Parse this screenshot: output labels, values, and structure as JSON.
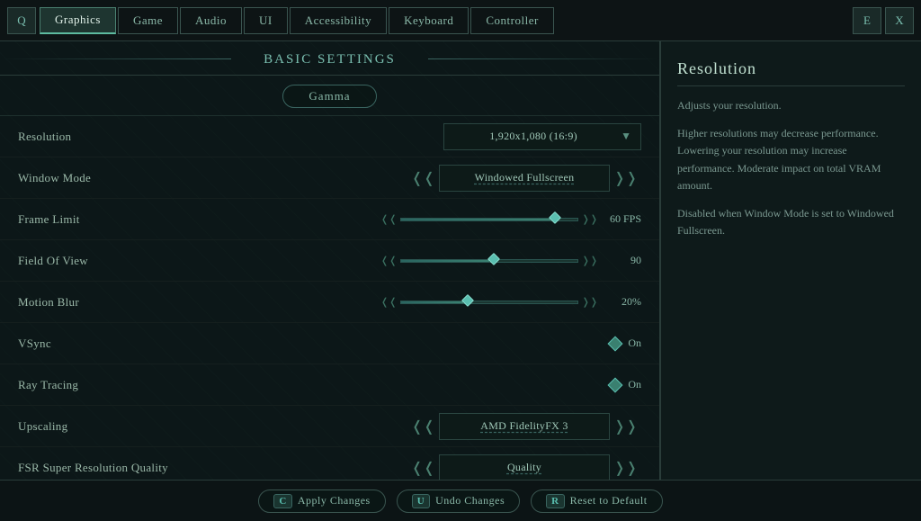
{
  "nav": {
    "q_label": "Q",
    "e_label": "E",
    "x_label": "X",
    "tabs": [
      {
        "id": "graphics",
        "label": "Graphics",
        "active": true
      },
      {
        "id": "game",
        "label": "Game",
        "active": false
      },
      {
        "id": "audio",
        "label": "Audio",
        "active": false
      },
      {
        "id": "ui",
        "label": "UI",
        "active": false
      },
      {
        "id": "accessibility",
        "label": "Accessibility",
        "active": false
      },
      {
        "id": "keyboard",
        "label": "Keyboard",
        "active": false
      },
      {
        "id": "controller",
        "label": "Controller",
        "active": false
      }
    ]
  },
  "section": {
    "title": "Basic Settings"
  },
  "gamma_btn": "Gamma",
  "settings": [
    {
      "id": "resolution",
      "label": "Resolution",
      "type": "dropdown",
      "value": "1,920x1,080 (16:9)"
    },
    {
      "id": "window-mode",
      "label": "Window Mode",
      "type": "arrow-select",
      "value": "Windowed Fullscreen"
    },
    {
      "id": "frame-limit",
      "label": "Frame Limit",
      "type": "slider",
      "value": "60 FPS",
      "fill_pct": 85
    },
    {
      "id": "field-of-view",
      "label": "Field Of View",
      "type": "slider",
      "value": "90",
      "fill_pct": 50
    },
    {
      "id": "motion-blur",
      "label": "Motion Blur",
      "type": "slider",
      "value": "20%",
      "fill_pct": 35
    },
    {
      "id": "vsync",
      "label": "VSync",
      "type": "toggle",
      "value": "On"
    },
    {
      "id": "ray-tracing",
      "label": "Ray Tracing",
      "type": "toggle",
      "value": "On"
    },
    {
      "id": "upscaling",
      "label": "Upscaling",
      "type": "arrow-select",
      "value": "AMD FidelityFX 3"
    },
    {
      "id": "fsr-quality",
      "label": "FSR Super Resolution Quality",
      "type": "arrow-select",
      "value": "Quality"
    }
  ],
  "info_panel": {
    "title": "Resolution",
    "paragraphs": [
      "Adjusts your resolution.",
      "Higher resolutions may decrease performance. Lowering your resolution may increase performance. Moderate impact on total VRAM amount.",
      "Disabled when Window Mode is set to Windowed Fullscreen."
    ]
  },
  "bottom_bar": {
    "apply": {
      "key": "C",
      "label": "Apply Changes"
    },
    "undo": {
      "key": "U",
      "label": "Undo Changes"
    },
    "reset": {
      "key": "R",
      "label": "Reset to Default"
    }
  }
}
